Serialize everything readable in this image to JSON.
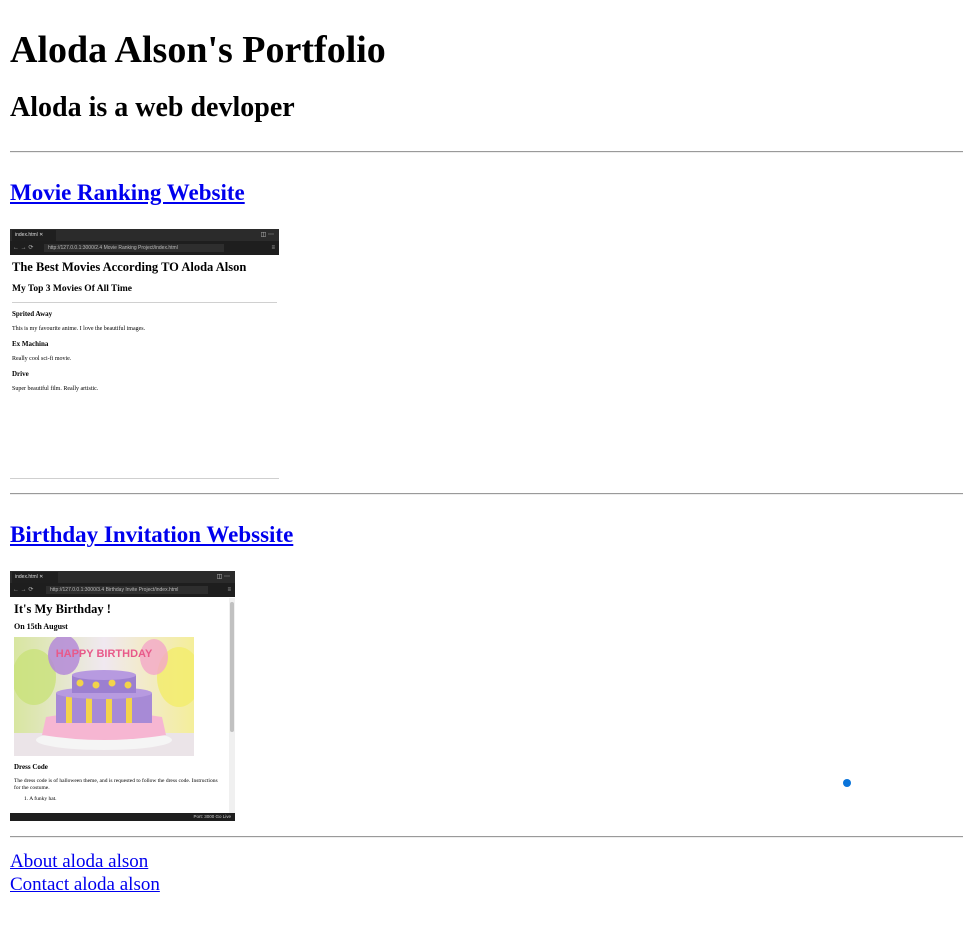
{
  "header": {
    "title": "Aloda Alson's Portfolio",
    "subtitle": "Aloda is a web devloper"
  },
  "projects": [
    {
      "link_label": "Movie Ranking Website",
      "preview": {
        "tab_label": "index.html",
        "url": "http://127.0.0.1:3000/2.4 Movie Ranking Project/index.html",
        "heading": "The Best Movies According TO Aloda Alson",
        "subheading": "My Top 3 Movies Of All Time",
        "movies": [
          {
            "title": "Sprited Away",
            "desc": "This is my favourite anime. I love the beautiful images."
          },
          {
            "title": "Ex Machina",
            "desc": "Really cool sci-fi movie."
          },
          {
            "title": "Drive",
            "desc": "Super beautiful film. Really artistic."
          }
        ]
      }
    },
    {
      "link_label": "Birthday Invitation Webssite",
      "preview": {
        "tab_label": "index.html",
        "url": "http://127.0.0.1:3000/3.4 Birthday Invite Project/index.html",
        "heading": "It's My Birthday !",
        "date": "On 15th August",
        "cake_text": "HAPPY BIRTHDAY",
        "dress_heading": "Dress Code",
        "dress_text": "The dress code is of halloween theme, and is requested to follow the dress code. Instructions for the costume.",
        "list_item": "1. A funky hat.",
        "status": "Port: 3000   Go Live"
      }
    }
  ],
  "footer_links": [
    {
      "label": "About aloda alson"
    },
    {
      "label": "Contact aloda alson"
    }
  ],
  "colors": {
    "link": "#0000ee",
    "rule": "#9a9a9a",
    "indicator": "#0a74da"
  }
}
